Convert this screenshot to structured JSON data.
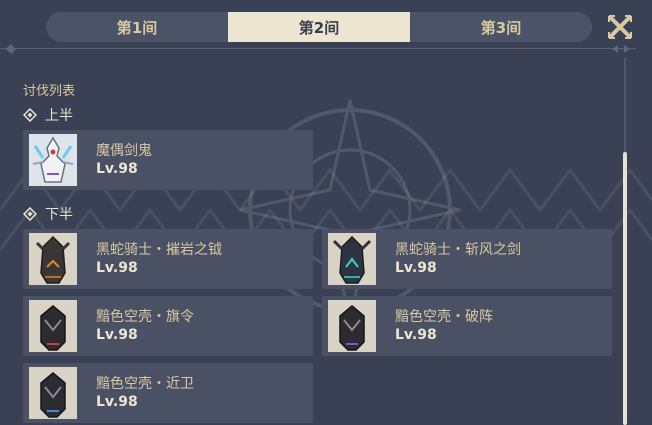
{
  "tabs": [
    {
      "label": "第1间",
      "active": false
    },
    {
      "label": "第2间",
      "active": true
    },
    {
      "label": "第3间",
      "active": false
    }
  ],
  "close_icon": "close-x-icon",
  "list_title": "讨伐列表",
  "sections": [
    {
      "label": "上半",
      "enemies": [
        {
          "name": "魔偶剑鬼",
          "level": "Lv.98",
          "icon": "ruin-guard-swordsman-portrait"
        }
      ]
    },
    {
      "label": "下半",
      "enemies": [
        {
          "name": "黑蛇骑士・摧岩之钺",
          "level": "Lv.98",
          "icon": "black-serpent-knight-rockbreaker-portrait"
        },
        {
          "name": "黑蛇骑士・斩风之剑",
          "level": "Lv.98",
          "icon": "black-serpent-knight-windcutter-portrait"
        },
        {
          "name": "黯色空壳・旗令",
          "level": "Lv.98",
          "icon": "shadowy-husk-standard-bearer-portrait"
        },
        {
          "name": "黯色空壳・破阵",
          "level": "Lv.98",
          "icon": "shadowy-husk-line-breaker-portrait"
        },
        {
          "name": "黯色空壳・近卫",
          "level": "Lv.98",
          "icon": "shadowy-husk-defender-portrait"
        }
      ]
    }
  ],
  "colors": {
    "background": "#3a4154",
    "card": "#4a5165",
    "gold_text": "#d8c9a3",
    "light_text": "#ece5d1",
    "active_tab": "#ece5d1"
  }
}
